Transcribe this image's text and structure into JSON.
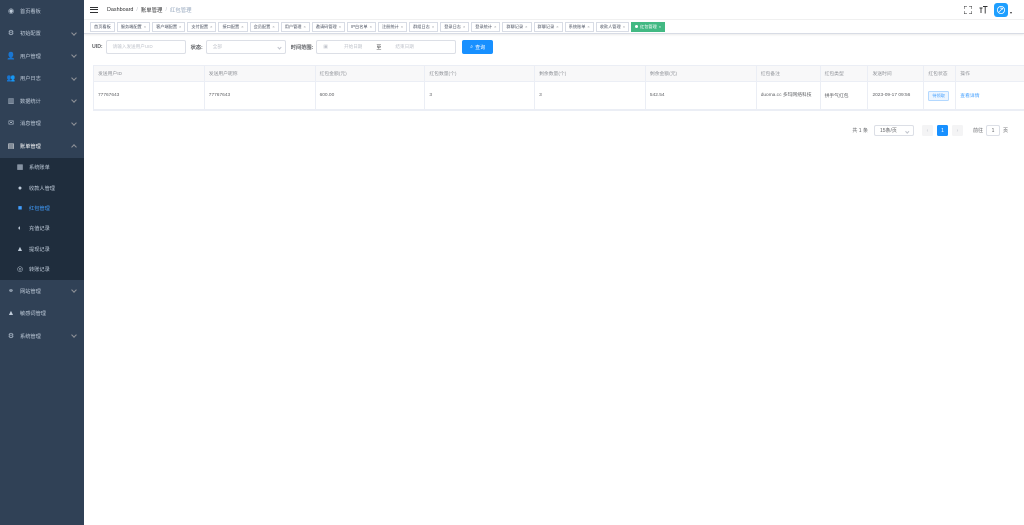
{
  "sidebar": {
    "items": [
      {
        "label": "首页看板",
        "icon": "dashboard-icon",
        "has_children": false
      },
      {
        "label": "初始配置",
        "icon": "settings-search-icon",
        "has_children": true
      },
      {
        "label": "用户管理",
        "icon": "user-add-icon",
        "has_children": true
      },
      {
        "label": "用户日志",
        "icon": "user-log-icon",
        "has_children": true
      },
      {
        "label": "数据统计",
        "icon": "chart-icon",
        "has_children": true
      },
      {
        "label": "消息管理",
        "icon": "message-icon",
        "has_children": true
      },
      {
        "label": "账单管理",
        "icon": "bill-icon",
        "has_children": true,
        "open": true
      }
    ],
    "submenu": [
      {
        "label": "系统账单",
        "icon": "document-icon"
      },
      {
        "label": "收款人管理",
        "icon": "payee-icon"
      },
      {
        "label": "红包管理",
        "icon": "redpacket-icon",
        "active": true
      },
      {
        "label": "充值记录",
        "icon": "recharge-icon"
      },
      {
        "label": "提现记录",
        "icon": "withdraw-icon"
      },
      {
        "label": "转账记录",
        "icon": "transfer-icon"
      }
    ],
    "items_after": [
      {
        "label": "网站管理",
        "icon": "website-icon",
        "has_children": true
      },
      {
        "label": "敏感词管理",
        "icon": "sensitive-word-icon",
        "has_children": false
      },
      {
        "label": "系统管理",
        "icon": "system-icon",
        "has_children": true
      }
    ]
  },
  "navbar": {
    "breadcrumb": [
      "Dashboard",
      "账单管理",
      "红包管理"
    ]
  },
  "tags": [
    {
      "label": "首页看板",
      "closable": false
    },
    {
      "label": "服务端配置",
      "closable": true
    },
    {
      "label": "客户端配置",
      "closable": true
    },
    {
      "label": "支付配置",
      "closable": true
    },
    {
      "label": "接口配置",
      "closable": true
    },
    {
      "label": "会员配置",
      "closable": true
    },
    {
      "label": "用户管理",
      "closable": true
    },
    {
      "label": "邀请码管理",
      "closable": true
    },
    {
      "label": "IP白名单",
      "closable": true
    },
    {
      "label": "注册统计",
      "closable": true
    },
    {
      "label": "群组日志",
      "closable": true
    },
    {
      "label": "登录日志",
      "closable": true
    },
    {
      "label": "登录统计",
      "closable": true
    },
    {
      "label": "群聊记录",
      "closable": true
    },
    {
      "label": "群聊记录",
      "closable": true
    },
    {
      "label": "系统账单",
      "closable": true
    },
    {
      "label": "收款人管理",
      "closable": true
    },
    {
      "label": "红包管理",
      "closable": true,
      "active": true
    }
  ],
  "filter": {
    "uid_label": "UID:",
    "uid_placeholder": "请输入发送用户UID",
    "status_label": "状态:",
    "status_value": "全部",
    "time_label": "时间范围:",
    "start_placeholder": "开始日期",
    "range_sep": "至",
    "end_placeholder": "结束日期",
    "search_label": "查询"
  },
  "table": {
    "headers": [
      "发送用户ID",
      "发送用户昵称",
      "红包金额(元)",
      "红包数量(个)",
      "剩余数量(个)",
      "剩余金额(元)",
      "红包备注",
      "红包类型",
      "发送时间",
      "红包状态",
      "操作"
    ],
    "rows": [
      {
        "uid": "77767643",
        "nickname": "77767643",
        "amount": "600.00",
        "count": "3",
        "remaining_count": "3",
        "remaining_amount": "542.54",
        "remark": "duoma.cc 多玛网络科技",
        "type": "拼手气红包",
        "time": "2023-09-17 09:56",
        "status": "待领取",
        "action": "查看详情"
      }
    ]
  },
  "pagination": {
    "total": "共 1 条",
    "page_size": "15条/页",
    "prev": "‹",
    "current": "1",
    "next": "›",
    "goto_prefix": "前往",
    "goto_value": "1",
    "goto_suffix": "页"
  },
  "colors": {
    "sidebar_bg": "#304156",
    "submenu_bg": "#1f2d3d",
    "primary": "#1890ff",
    "active_tag": "#42b983",
    "avatar": "#1e9fff"
  }
}
